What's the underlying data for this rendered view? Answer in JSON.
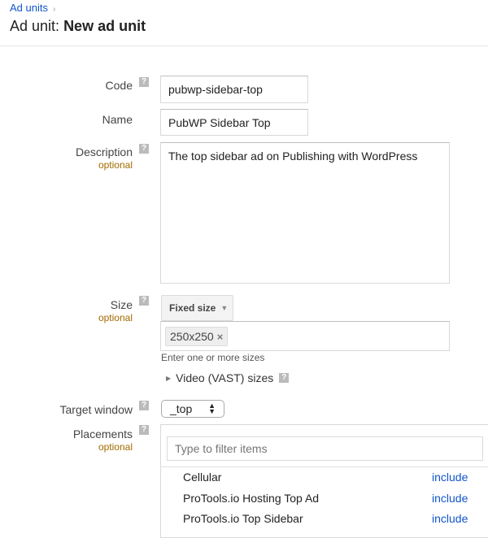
{
  "breadcrumb": {
    "parent": "Ad units",
    "separator": "›"
  },
  "title": {
    "prefix": "Ad unit:",
    "name": "New ad unit"
  },
  "help_glyph": "?",
  "form": {
    "code": {
      "label": "Code",
      "value": "pubwp-sidebar-top"
    },
    "name": {
      "label": "Name",
      "value": "PubWP Sidebar Top"
    },
    "description": {
      "label": "Description",
      "optional": "optional",
      "value": "The top sidebar ad on Publishing with WordPress"
    },
    "size": {
      "label": "Size",
      "optional": "optional",
      "type_button": "Fixed size",
      "sizes": [
        "250x250"
      ],
      "remove_glyph": "×",
      "hint": "Enter one or more sizes",
      "video_toggle": "Video (VAST) sizes"
    },
    "target_window": {
      "label": "Target window",
      "value": "_top"
    },
    "placements": {
      "label": "Placements",
      "optional": "optional",
      "filter_placeholder": "Type to filter items",
      "items": [
        {
          "name": "Cellular",
          "action": "include"
        },
        {
          "name": "ProTools.io Hosting Top Ad",
          "action": "include"
        },
        {
          "name": "ProTools.io Top Sidebar",
          "action": "include"
        }
      ]
    }
  },
  "colors": {
    "link": "#1155cc",
    "optional": "#a36b00"
  }
}
